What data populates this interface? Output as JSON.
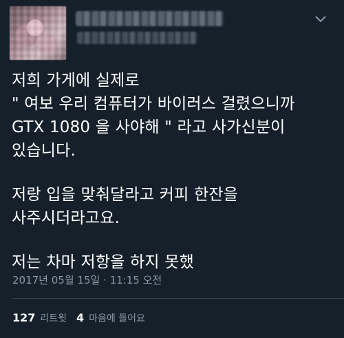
{
  "tweet": {
    "lines": [
      "저희 가게에 실제로",
      "\" 여보 우리 컴퓨터가 바이러스 걸렸으니까",
      "GTX 1080 을 사야해 \" 라고 사가신분이",
      "있습니다.",
      "저랑 입을 맞춰달라고 커피 한잔을",
      "사주시더라고요.",
      "저는 차마 저항을 하지 못했"
    ],
    "timestamp": "2017년 05월 15일 · 11:15 오전"
  },
  "stats": {
    "retweets_count": "127",
    "retweets_label": "리트윗",
    "likes_count": "4",
    "likes_label": "마음에 들어요"
  },
  "icons": {
    "menu": "chevron-down-icon"
  },
  "colors": {
    "background": "#15202b",
    "text_primary": "#ffffff",
    "text_secondary": "#8899a6",
    "divider": "#38444d"
  }
}
